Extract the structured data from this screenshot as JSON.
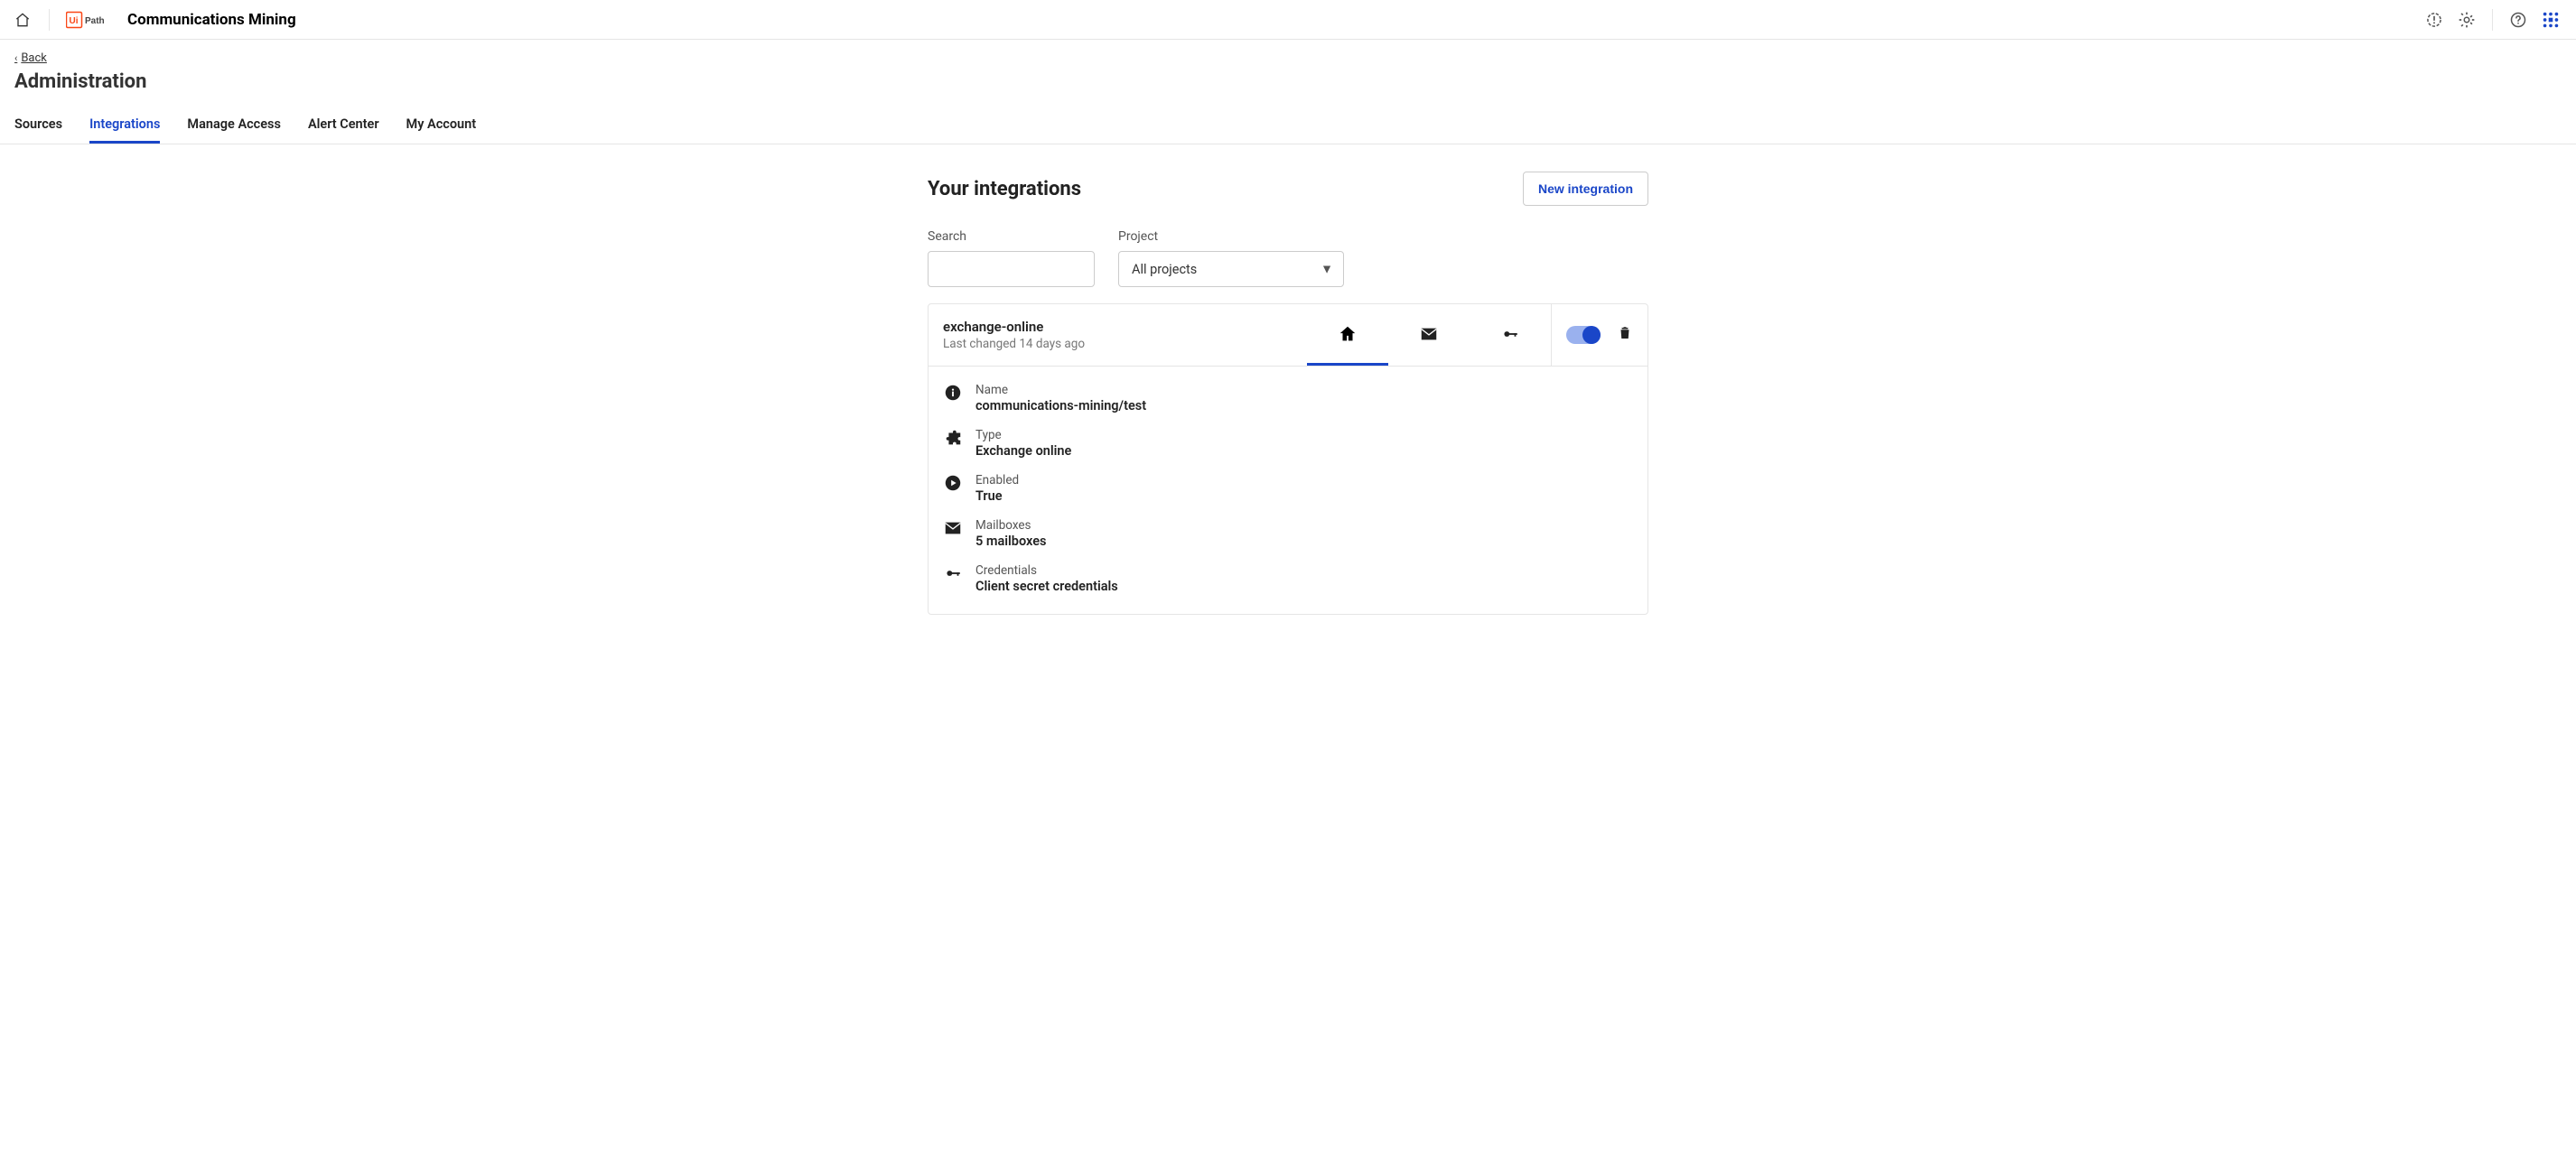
{
  "brand": {
    "product_name": "Communications Mining"
  },
  "back": {
    "label": "Back"
  },
  "page": {
    "title": "Administration"
  },
  "tabs": [
    {
      "id": "sources",
      "label": "Sources",
      "active": false
    },
    {
      "id": "integrations",
      "label": "Integrations",
      "active": true
    },
    {
      "id": "manage-access",
      "label": "Manage Access",
      "active": false
    },
    {
      "id": "alert-center",
      "label": "Alert Center",
      "active": false
    },
    {
      "id": "my-account",
      "label": "My Account",
      "active": false
    }
  ],
  "section": {
    "title": "Your integrations",
    "new_button": "New integration"
  },
  "filters": {
    "search_label": "Search",
    "search_value": "",
    "project_label": "Project",
    "project_selected": "All projects"
  },
  "integration": {
    "name": "exchange-online",
    "subtitle": "Last changed 14 days ago",
    "enabled_toggle": true,
    "mini_tabs": [
      {
        "id": "overview",
        "icon": "home",
        "active": true
      },
      {
        "id": "mailboxes",
        "icon": "mail",
        "active": false
      },
      {
        "id": "credentials",
        "icon": "key",
        "active": false
      }
    ],
    "details": [
      {
        "icon": "info",
        "label": "Name",
        "value": "communications-mining/test"
      },
      {
        "icon": "puzzle",
        "label": "Type",
        "value": "Exchange online"
      },
      {
        "icon": "play",
        "label": "Enabled",
        "value": "True"
      },
      {
        "icon": "mail",
        "label": "Mailboxes",
        "value": "5 mailboxes"
      },
      {
        "icon": "key",
        "label": "Credentials",
        "value": "Client secret credentials"
      }
    ]
  }
}
